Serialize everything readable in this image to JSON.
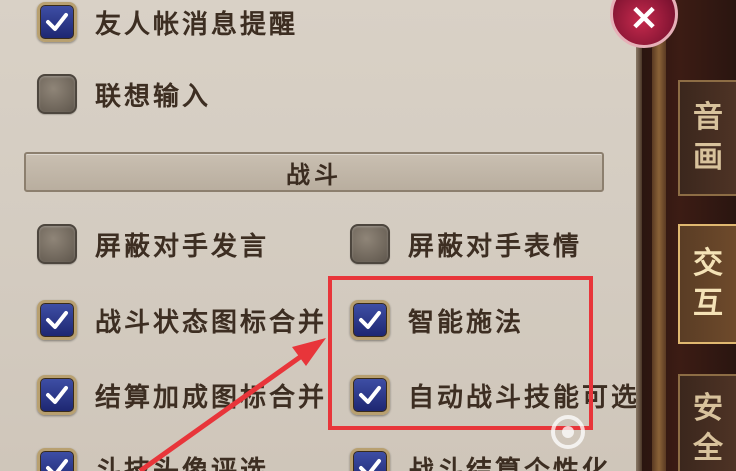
{
  "settings": {
    "rows_top": [
      {
        "label": "友人帐消息提醒",
        "checked": true
      },
      {
        "label": "联想输入",
        "checked": false
      }
    ],
    "section_title": "战斗",
    "grid": [
      {
        "label": "屏蔽对手发言",
        "checked": false
      },
      {
        "label": "屏蔽对手表情",
        "checked": false
      },
      {
        "label": "战斗状态图标合并",
        "checked": true
      },
      {
        "label": "智能施法",
        "checked": true
      },
      {
        "label": "结算加成图标合并",
        "checked": true
      },
      {
        "label": "自动战斗技能可选",
        "checked": true
      },
      {
        "label": "斗技头像评选",
        "checked": true
      },
      {
        "label": "战斗结算个性化",
        "checked": true
      }
    ]
  },
  "side_tabs": [
    {
      "label": "音画",
      "active": false
    },
    {
      "label": "交互",
      "active": true
    },
    {
      "label": "安全",
      "active": false
    }
  ],
  "close_button": {
    "icon": "✕"
  },
  "colors": {
    "highlight_box": "#e8353a",
    "checkbox_on": "#2a358c",
    "checkbox_off": "#766c60"
  }
}
